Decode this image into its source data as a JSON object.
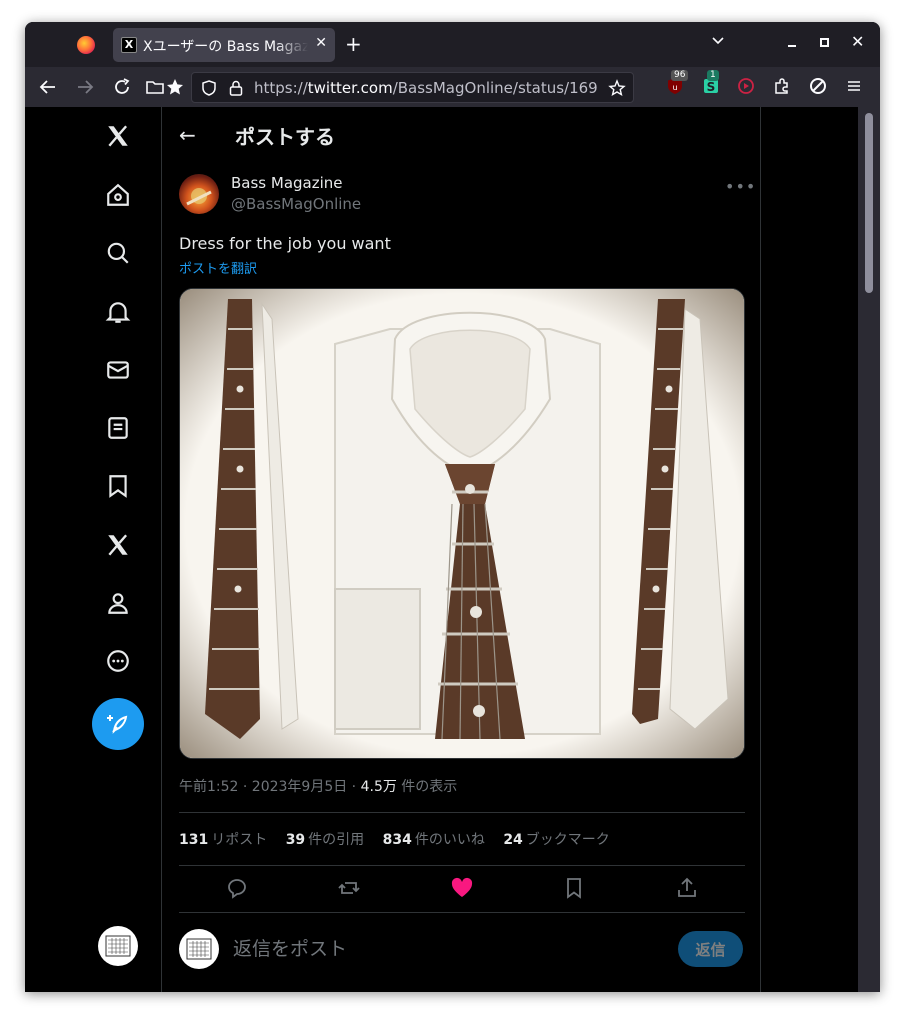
{
  "browser": {
    "tab_title": "Xユーザーの Bass Magazine",
    "tab_favicon_glyph": "X",
    "url_prefix": "https://",
    "url_host": "twitter.com",
    "url_path": "/BassMagOnline/status/169",
    "ext_badge_1": "96",
    "ext_badge_2": "1",
    "new_tab_glyph": "+",
    "close_tab_glyph": "✕"
  },
  "header": {
    "back_glyph": "←",
    "title": "ポストする"
  },
  "post": {
    "author_name": "Bass Magazine",
    "author_handle": "@BassMagOnline",
    "more_glyph": "•••",
    "text": "Dress for the job you want",
    "translate_link": "ポストを翻訳",
    "meta_time": "午前1:52 · 2023年9月5日 · ",
    "meta_views_num": "4.5万",
    "meta_views_label": " 件の表示",
    "stats": [
      {
        "num": "131",
        "label": "リポスト"
      },
      {
        "num": "39",
        "label": "件の引用"
      },
      {
        "num": "834",
        "label": "件のいいね"
      },
      {
        "num": "24",
        "label": "ブックマーク"
      }
    ]
  },
  "reply": {
    "placeholder": "返信をポスト",
    "button_label": "返信"
  },
  "colors": {
    "accent": "#1d9bf0",
    "like": "#f91880",
    "background": "#000000",
    "text": "#e7e9ea",
    "muted": "#71767b"
  }
}
